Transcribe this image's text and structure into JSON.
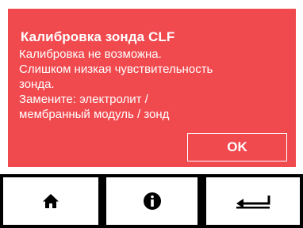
{
  "alert": {
    "title": "Калибровка зонда CLF",
    "message_lines": [
      "Калибровка не возможна.",
      "Слишком низкая чувствительность",
      "зонда.",
      "Замените: электролит /",
      "мембранный модуль / зонд"
    ],
    "ok_label": "OK",
    "background_color": "#f04a4f"
  },
  "nav": {
    "buttons": [
      {
        "icon": "home-icon"
      },
      {
        "icon": "info-icon"
      },
      {
        "icon": "back-arrow-icon"
      }
    ]
  }
}
